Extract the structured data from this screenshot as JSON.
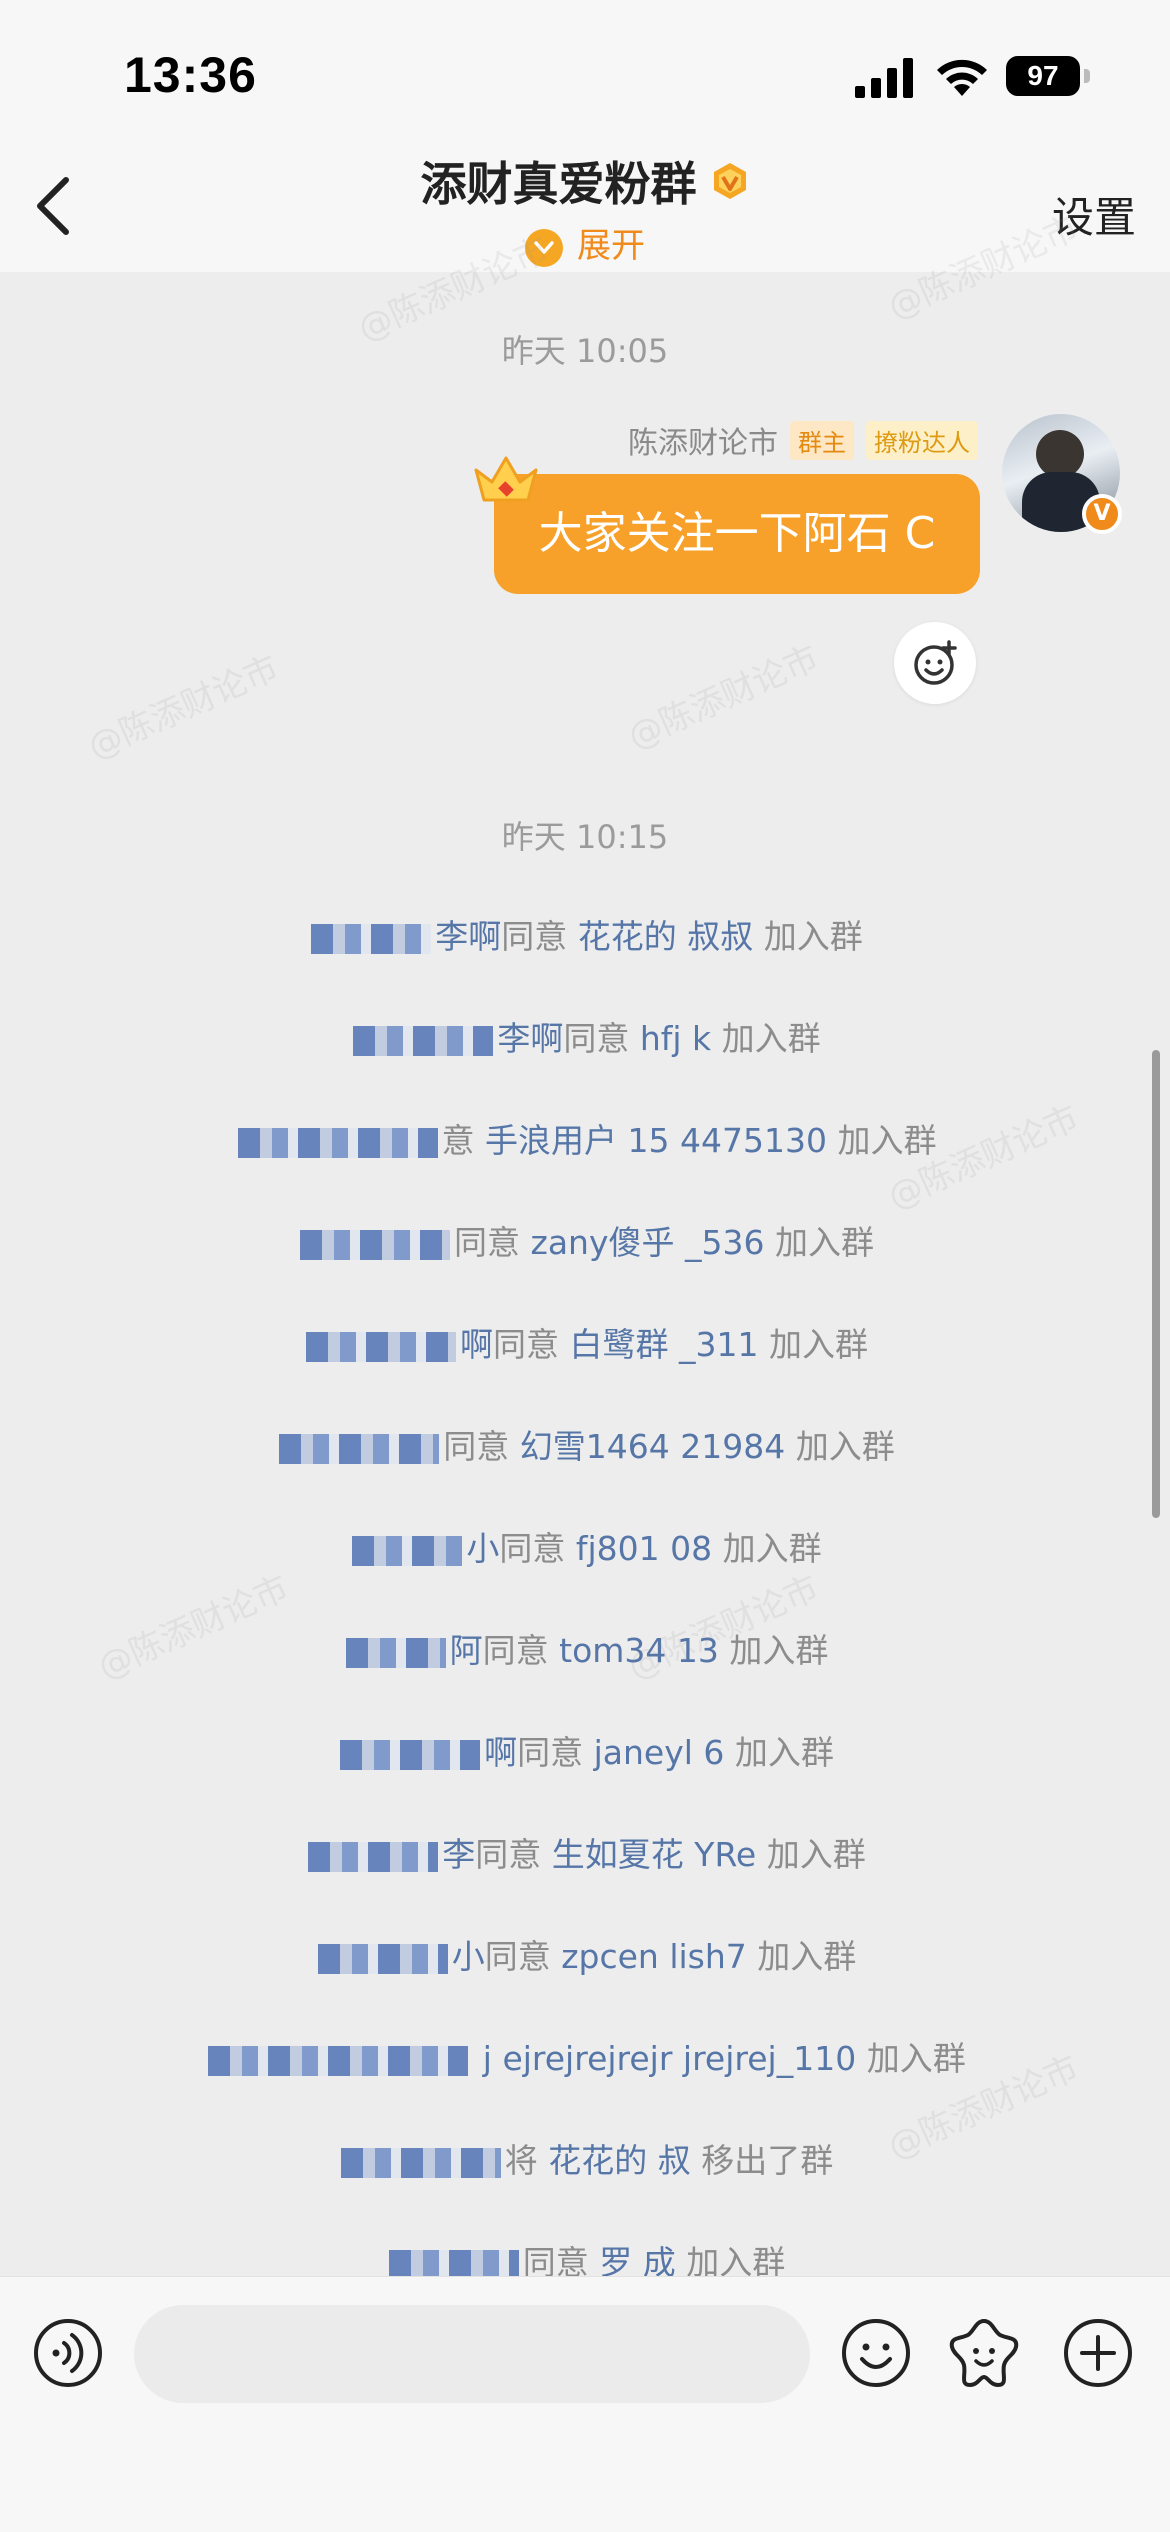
{
  "status_bar": {
    "time": "13:36",
    "battery": "97"
  },
  "header": {
    "title": "添财真爱粉群",
    "expand_label": "展开",
    "settings_label": "设置"
  },
  "watermark_text": "@陈添财论市",
  "messages": {
    "timestamp_1": "昨天 10:05",
    "sender_name": "陈添财论市",
    "sender_tag_owner": "群主",
    "sender_tag_fan": "撩粉达人",
    "bubble_text": "大家关注一下阿石 C",
    "timestamp_2": "昨天 10:15"
  },
  "system_messages": [
    {
      "pre": "李啊",
      "verb": "同意",
      "name": "花花的 叔叔",
      "action": "加入群"
    },
    {
      "pre": "李啊",
      "verb": "同意",
      "name": "hfj k",
      "action": "加入群"
    },
    {
      "pre": "",
      "verb": "意",
      "name": "手浪用户 15 4475130",
      "action": "加入群"
    },
    {
      "pre": "",
      "verb": "同意",
      "name": "zany傻乎 _536",
      "action": "加入群"
    },
    {
      "pre": "啊",
      "verb": "同意",
      "name": "白鹭群 _311",
      "action": "加入群"
    },
    {
      "pre": "",
      "verb": "同意",
      "name": "幻雪1464 21984",
      "action": "加入群"
    },
    {
      "pre": "小",
      "verb": "同意",
      "name": "fj801 08",
      "action": "加入群"
    },
    {
      "pre": "阿",
      "verb": "同意",
      "name": "tom34 13",
      "action": "加入群"
    },
    {
      "pre": "啊",
      "verb": "同意",
      "name": "janeyl 6",
      "action": "加入群"
    },
    {
      "pre": "李",
      "verb": "同意",
      "name": "生如夏花 YRe",
      "action": "加入群"
    },
    {
      "pre": "小",
      "verb": "同意",
      "name": "zpcen lish7",
      "action": "加入群"
    },
    {
      "pre": "",
      "verb": "",
      "name": "j ejrejrejrejr jrejrej_110",
      "action": "加入群"
    },
    {
      "pre": "",
      "verb": "将",
      "name": "花花的 叔",
      "action": "移出了群"
    },
    {
      "pre": "",
      "verb": "同意",
      "name": "罗 成",
      "action": "加入群"
    }
  ],
  "input": {
    "placeholder": ""
  },
  "icons": {
    "voice": "voice-icon",
    "emoji": "emoji-icon",
    "sticker": "sticker-icon",
    "plus": "plus-icon",
    "back": "back-chevron-icon",
    "crown": "crown-icon",
    "reaction": "add-reaction-icon"
  },
  "colors": {
    "accent": "#f08a1a",
    "bubble": "#f7a02a",
    "name_link": "#5676a8"
  }
}
